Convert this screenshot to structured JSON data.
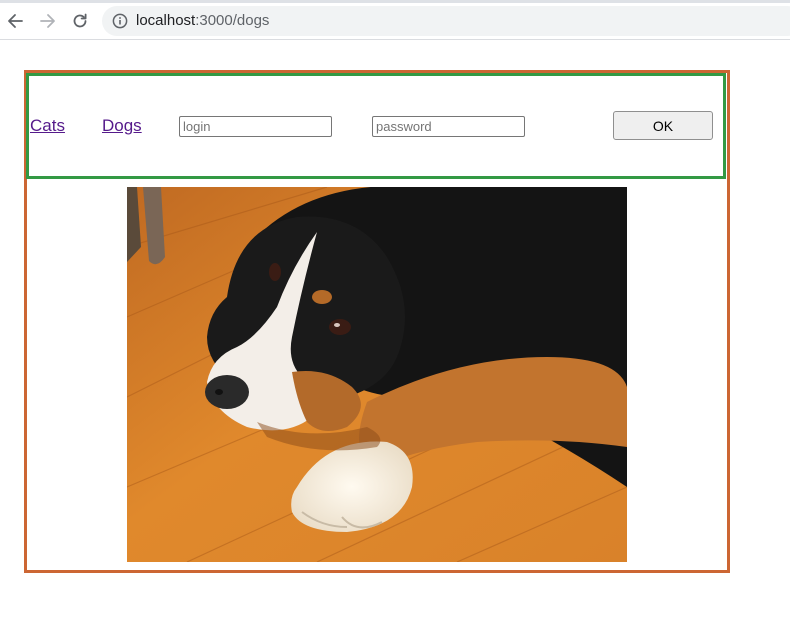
{
  "browser": {
    "url_host": "localhost",
    "url_path": ":3000/dogs"
  },
  "header": {
    "links": [
      {
        "label": "Cats"
      },
      {
        "label": "Dogs"
      }
    ],
    "login": {
      "placeholder": "login",
      "value": ""
    },
    "password": {
      "placeholder": "password",
      "value": ""
    },
    "ok_label": "OK"
  },
  "content": {
    "image_subject": "dog-photo"
  },
  "colors": {
    "outer_border": "#cc6633",
    "header_border": "#339944",
    "visited_link": "#551a8b"
  }
}
